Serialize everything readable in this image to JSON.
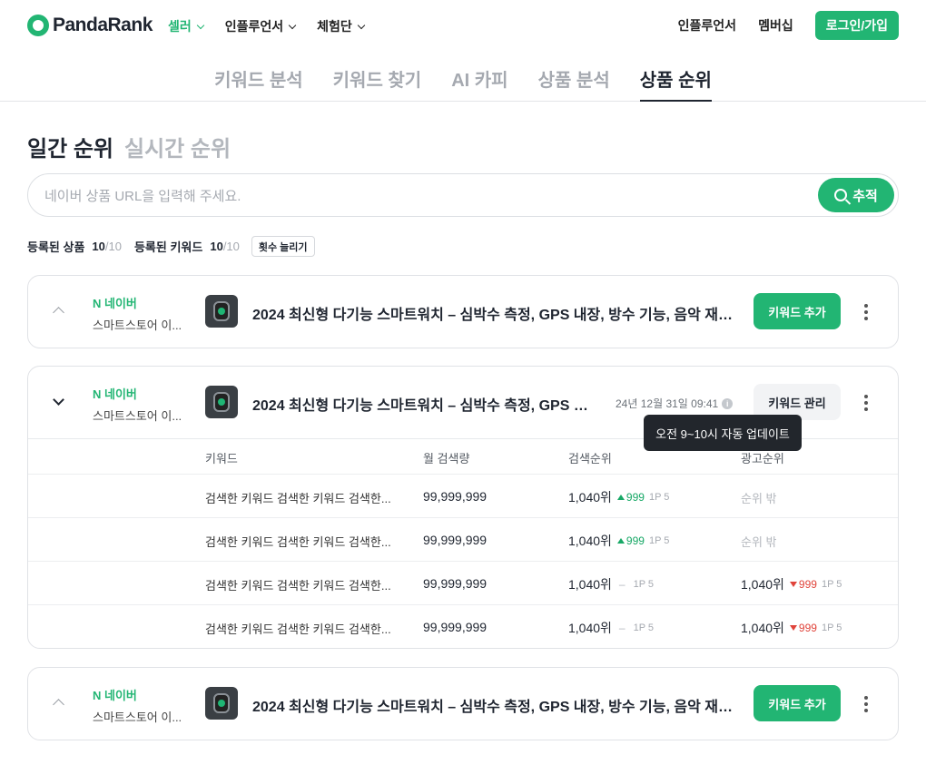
{
  "header": {
    "logo": "PandaRank",
    "nav": [
      {
        "label": "셀러",
        "active": true
      },
      {
        "label": "인플루언서",
        "active": false
      },
      {
        "label": "체험단",
        "active": false
      }
    ],
    "right": {
      "influencer": "인플루언서",
      "membership": "멤버십",
      "login": "로그인/가입"
    }
  },
  "tabs": [
    "키워드 분석",
    "키워드 찾기",
    "AI 카피",
    "상품 분석",
    "상품 순위"
  ],
  "rank_type": {
    "daily": "일간 순위",
    "realtime": "실시간 순위"
  },
  "search": {
    "placeholder": "네이버 상품 URL을 입력해 주세요.",
    "button": "추적"
  },
  "counts": {
    "products_label": "등록된 상품",
    "products": "10",
    "products_total": "/10",
    "keywords_label": "등록된 키워드",
    "keywords": "10",
    "keywords_total": "/10",
    "increase": "횟수 늘리기"
  },
  "product": {
    "platform": "N 네이버",
    "store": "스마트스토어 이...",
    "title": "2024 최신형 다기능 스마트워치 – 심박수 측정, GPS 내장, 방수 기능, 음악 재생, 통...",
    "title_short": "2024 최신형 다기능 스마트워치 – 심박수 측정, GPS 내장,...",
    "add_keyword": "키워드 추가",
    "manage_keyword": "키워드 관리",
    "updated": "24년 12월 31일 09:41",
    "tooltip": "오전 9~10시 자동 업데이트"
  },
  "table": {
    "headers": {
      "keyword": "키워드",
      "volume": "월 검색량",
      "search_rank": "검색순위",
      "ad_rank": "광고순위"
    },
    "rows": [
      {
        "keyword": "검색한 키워드 검색한 키워드 검색한...",
        "volume": "99,999,999",
        "rank": "1,040위",
        "delta": "999",
        "dir": "up",
        "page": "1P 5",
        "ad": "순위 밖"
      },
      {
        "keyword": "검색한 키워드 검색한 키워드 검색한...",
        "volume": "99,999,999",
        "rank": "1,040위",
        "delta": "999",
        "dir": "up",
        "page": "1P 5",
        "ad": "순위 밖"
      },
      {
        "keyword": "검색한 키워드 검색한 키워드 검색한...",
        "volume": "99,999,999",
        "rank": "1,040위",
        "delta": "–",
        "dir": "none",
        "page": "1P 5",
        "ad_rank": "1,040위",
        "ad_delta": "999",
        "ad_page": "1P 5"
      },
      {
        "keyword": "검색한 키워드 검색한 키워드 검색한...",
        "volume": "99,999,999",
        "rank": "1,040위",
        "delta": "–",
        "dir": "none",
        "page": "1P 5",
        "ad_rank": "1,040위",
        "ad_delta": "999",
        "ad_page": "1P 5"
      }
    ]
  },
  "colors": {
    "brand": "#22b573",
    "up": "#17a866",
    "down": "#e0443b"
  }
}
